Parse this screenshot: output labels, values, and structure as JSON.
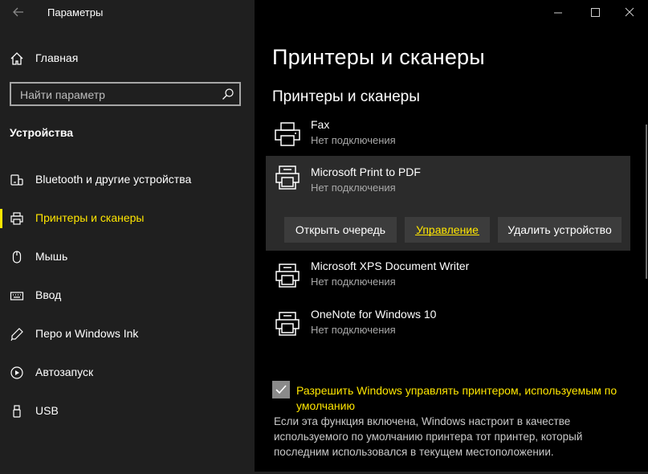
{
  "window": {
    "title": "Параметры",
    "controls": [
      "minimize-icon",
      "maximize-icon",
      "close-icon"
    ]
  },
  "sidebar": {
    "home_label": "Главная",
    "search_placeholder": "Найти параметр",
    "section_title": "Устройства",
    "items": [
      {
        "label": "Bluetooth и другие устройства",
        "icon": "bluetooth-devices-icon",
        "active": false
      },
      {
        "label": "Принтеры и сканеры",
        "icon": "printer-icon",
        "active": true
      },
      {
        "label": "Мышь",
        "icon": "mouse-icon",
        "active": false
      },
      {
        "label": "Ввод",
        "icon": "keyboard-icon",
        "active": false
      },
      {
        "label": "Перо и Windows Ink",
        "icon": "pen-icon",
        "active": false
      },
      {
        "label": "Автозапуск",
        "icon": "autoplay-icon",
        "active": false
      },
      {
        "label": "USB",
        "icon": "usb-icon",
        "active": false
      }
    ]
  },
  "main": {
    "page_title": "Принтеры и сканеры",
    "section_title": "Принтеры и сканеры",
    "printers": [
      {
        "name": "Fax",
        "status": "Нет подключения",
        "icon": "fax-icon"
      },
      {
        "name": "Microsoft Print to PDF",
        "status": "Нет подключения",
        "icon": "printer-icon",
        "selected": true
      },
      {
        "name": "Microsoft XPS Document Writer",
        "status": "Нет подключения",
        "icon": "printer-icon"
      },
      {
        "name": "OneNote for Windows 10",
        "status": "Нет подключения",
        "icon": "printer-icon"
      }
    ],
    "actions": {
      "open_queue": "Открыть очередь",
      "manage": "Управление",
      "remove": "Удалить устройство"
    },
    "default_printer": {
      "checked": true,
      "label": "Разрешить Windows управлять принтером, используемым по умолчанию",
      "description": "Если эта функция включена, Windows настроит в качестве используемого по умолчанию принтера тот принтер, который последним использовался в текущем местоположении."
    }
  },
  "colors": {
    "accent": "#ffe600",
    "sidebar_bg": "#1f1f1f",
    "main_bg": "#000000",
    "selected_bg": "#2b2b2b",
    "button_bg": "#3c3c3c"
  }
}
